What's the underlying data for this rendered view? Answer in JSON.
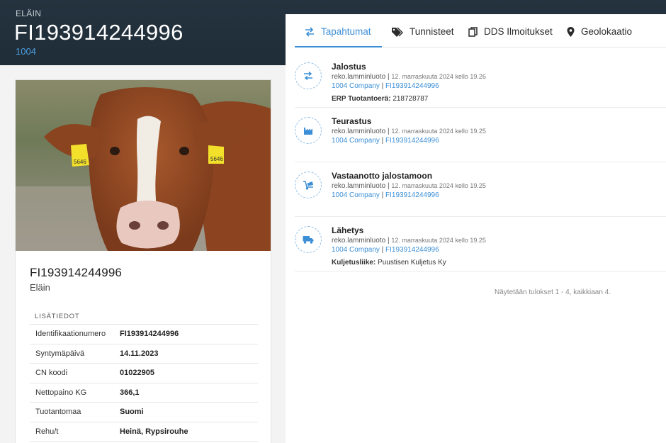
{
  "header": {
    "kicker": "ELÄIN",
    "title": "FI193914244996",
    "subtitle": "1004"
  },
  "animal": {
    "id": "FI193914244996",
    "type": "Eläin",
    "ear_tag_text": "5646"
  },
  "details": {
    "heading": "LISÄTIEDOT",
    "rows": [
      {
        "label": "Identifikaationumero",
        "value": "FI193914244996"
      },
      {
        "label": "Syntymäpäivä",
        "value": "14.11.2023"
      },
      {
        "label": "CN koodi",
        "value": "01022905"
      },
      {
        "label": "Nettopaino KG",
        "value": "366,1"
      },
      {
        "label": "Tuotantomaa",
        "value": "Suomi"
      },
      {
        "label": "Rehu/t",
        "value": "Heinä, Rypsirouhe"
      }
    ]
  },
  "tabs": [
    {
      "label": "Tapahtumat",
      "icon": "arrows-exchange-icon",
      "active": true
    },
    {
      "label": "Tunnisteet",
      "icon": "tag-icon",
      "active": false
    },
    {
      "label": "DDS Ilmoitukset",
      "icon": "copy-icon",
      "active": false
    },
    {
      "label": "Geolokaatio",
      "icon": "map-marker-icon",
      "active": false
    }
  ],
  "events": [
    {
      "title": "Jalostus",
      "icon": "arrows-exchange-icon",
      "user": "reko.lamminluoto",
      "sep": "|",
      "time": "12. marraskuuta 2024 kello 19.26",
      "company": "1004 Company",
      "item": "FI193914244996",
      "extra_label": "ERP Tuotantoerä:",
      "extra_value": "218728787"
    },
    {
      "title": "Teurastus",
      "icon": "factory-icon",
      "user": "reko.lamminluoto",
      "sep": "|",
      "time": "12. marraskuuta 2024 kello 19.25",
      "company": "1004 Company",
      "item": "FI193914244996"
    },
    {
      "title": "Vastaanotto jalostamoon",
      "icon": "dolly-icon",
      "user": "reko.lamminluoto",
      "sep": "|",
      "time": "12. marraskuuta 2024 kello 19.25",
      "company": "1004 Company",
      "item": "FI193914244996"
    },
    {
      "title": "Lähetys",
      "icon": "truck-icon",
      "user": "reko.lamminluoto",
      "sep": "|",
      "time": "12. marraskuuta 2024 kello 19.25",
      "company": "1004 Company",
      "item": "FI193914244996",
      "extra_label": "Kuljetusliike:",
      "extra_value": "Puustisen Kuljetus Ky"
    }
  ],
  "footer": "Näytetään tulokset 1 - 4, kaikkiaan 4.",
  "colors": {
    "header_bg": "#1f2d38",
    "accent": "#3c8fd6",
    "link": "#3c8fd6"
  }
}
